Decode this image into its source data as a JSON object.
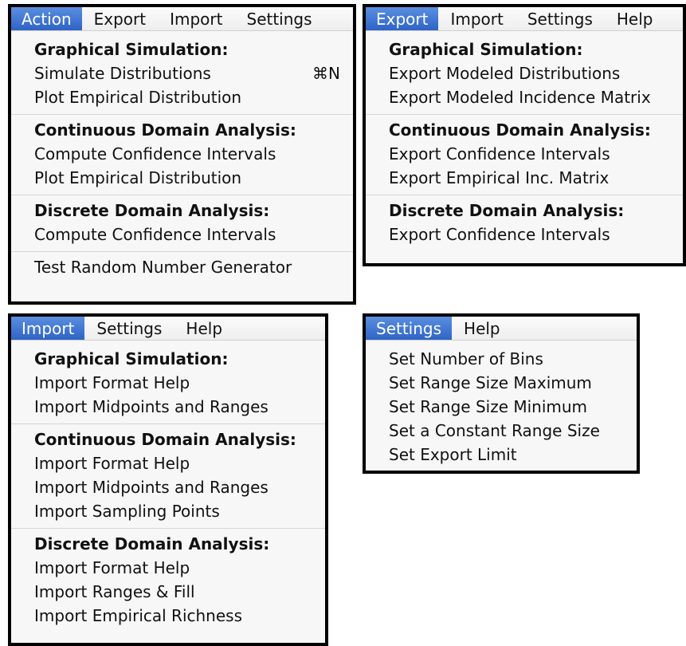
{
  "action_menu": {
    "menubar": [
      "Action",
      "Export",
      "Import",
      "Settings"
    ],
    "sections": [
      {
        "heading": "Graphical Simulation:",
        "items": [
          {
            "label": "Simulate Distributions",
            "shortcut": "⌘N"
          },
          {
            "label": "Plot Empirical Distribution"
          }
        ]
      },
      {
        "heading": "Continuous Domain Analysis:",
        "items": [
          {
            "label": "Compute Confidence Intervals"
          },
          {
            "label": "Plot Empirical Distribution"
          }
        ]
      },
      {
        "heading": "Discrete Domain Analysis:",
        "items": [
          {
            "label": "Compute Confidence Intervals"
          }
        ]
      },
      {
        "heading": "",
        "items": [
          {
            "label": "Test Random Number Generator"
          }
        ]
      }
    ]
  },
  "export_menu": {
    "menubar": [
      "Export",
      "Import",
      "Settings",
      "Help"
    ],
    "sections": [
      {
        "heading": "Graphical Simulation:",
        "items": [
          {
            "label": "Export Modeled Distributions"
          },
          {
            "label": "Export Modeled Incidence Matrix"
          }
        ]
      },
      {
        "heading": "Continuous Domain Analysis:",
        "items": [
          {
            "label": "Export Confidence Intervals"
          },
          {
            "label": "Export Empirical Inc. Matrix"
          }
        ]
      },
      {
        "heading": "Discrete Domain Analysis:",
        "items": [
          {
            "label": "Export Confidence Intervals"
          }
        ]
      }
    ]
  },
  "import_menu": {
    "menubar": [
      "Import",
      "Settings",
      "Help"
    ],
    "sections": [
      {
        "heading": "Graphical Simulation:",
        "items": [
          {
            "label": "Import Format Help"
          },
          {
            "label": "Import Midpoints and Ranges"
          }
        ]
      },
      {
        "heading": "Continuous Domain Analysis:",
        "items": [
          {
            "label": "Import Format Help"
          },
          {
            "label": "Import Midpoints and Ranges"
          },
          {
            "label": "Import Sampling Points"
          }
        ]
      },
      {
        "heading": "Discrete Domain Analysis:",
        "items": [
          {
            "label": "Import Format Help"
          },
          {
            "label": "Import Ranges & Fill"
          },
          {
            "label": "Import Empirical Richness"
          }
        ]
      }
    ]
  },
  "settings_menu": {
    "menubar": [
      "Settings",
      "Help"
    ],
    "sections": [
      {
        "heading": "",
        "items": [
          {
            "label": "Set Number of Bins"
          },
          {
            "label": "Set Range Size Maximum"
          },
          {
            "label": "Set Range Size Minimum"
          },
          {
            "label": "Set a Constant Range Size"
          },
          {
            "label": "Set Export Limit"
          }
        ]
      }
    ]
  },
  "colors": {
    "active_highlight": "#3a6fd0",
    "panel_border": "#000000",
    "menu_bg": "#f7f7f7"
  }
}
